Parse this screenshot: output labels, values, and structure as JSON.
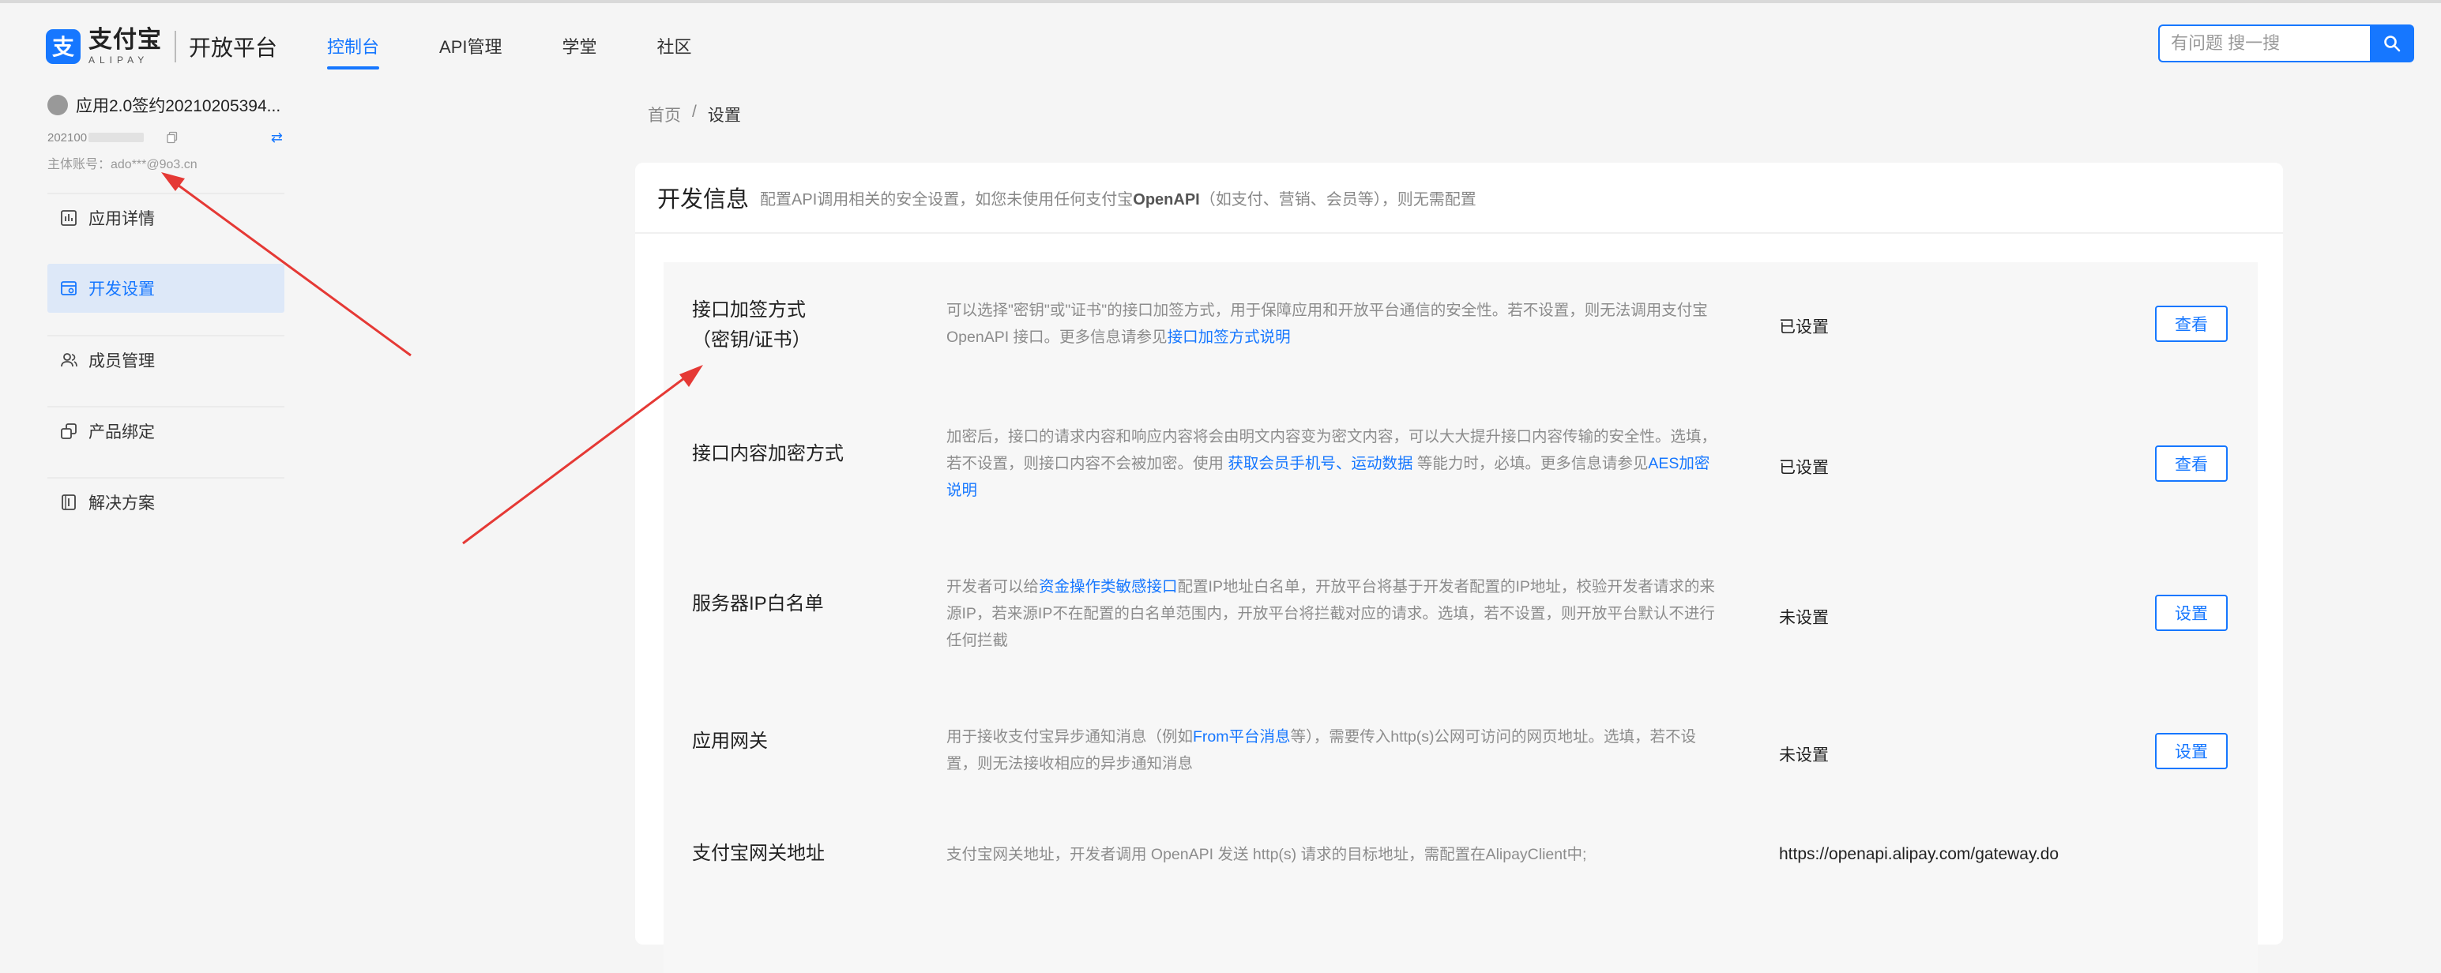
{
  "header": {
    "logo_cn": "支付宝",
    "logo_en": "ALIPAY",
    "platform": "开放平台",
    "nav": [
      {
        "label": "控制台",
        "active": true
      },
      {
        "label": "API管理",
        "active": false
      },
      {
        "label": "学堂",
        "active": false
      },
      {
        "label": "社区",
        "active": false
      }
    ],
    "search_placeholder": "有问题 搜一搜"
  },
  "sidebar": {
    "app_name": "应用2.0签约20210205394...",
    "app_id_prefix": "202100",
    "owner": "主体账号：ado***@9o3.cn",
    "items": [
      {
        "label": "应用详情",
        "icon": "chart-icon",
        "active": false
      },
      {
        "label": "开发设置",
        "icon": "dev-settings-icon",
        "active": true
      },
      {
        "label": "成员管理",
        "icon": "members-icon",
        "active": false
      },
      {
        "label": "产品绑定",
        "icon": "product-link-icon",
        "active": false
      },
      {
        "label": "解决方案",
        "icon": "solution-icon",
        "active": false
      }
    ]
  },
  "breadcrumb": {
    "home": "首页",
    "sep": "/",
    "current": "设置"
  },
  "card": {
    "title": "开发信息",
    "desc_prefix": "配置API调用相关的安全设置，如您未使用任何支付宝",
    "desc_bold": "OpenAPI",
    "desc_suffix": "（如支付、营销、会员等），则无需配置"
  },
  "rows": [
    {
      "name_line1": "接口加签方式",
      "name_line2": "（密钥/证书）",
      "desc_a": "可以选择\"密钥\"或\"证书\"的接口加签方式，用于保障应用和开放平台通信的安全性。若不设置，则无法调用支付宝 OpenAPI 接口。更多信息请参见",
      "desc_link": "接口加签方式说明",
      "status": "已设置",
      "button": "查看"
    },
    {
      "name": "接口内容加密方式",
      "desc_a": "加密后，接口的请求内容和响应内容将会由明文内容变为密文内容，可以大大提升接口内容传输的安全性。选填，若不设置，则接口内容不会被加密。使用 ",
      "desc_link1": "获取会员手机号",
      "desc_b": "、",
      "desc_link2": "运动数据",
      "desc_c": " 等能力时，必填。更多信息请参见",
      "desc_link3": "AES加密说明",
      "status": "已设置",
      "button": "查看"
    },
    {
      "name": "服务器IP白名单",
      "desc_a": "开发者可以给",
      "desc_link": "资金操作类敏感接口",
      "desc_b": "配置IP地址白名单，开放平台将基于开发者配置的IP地址，校验开发者请求的来源IP，若来源IP不在配置的白名单范围内，开放平台将拦截对应的请求。选填，若不设置，则开放平台默认不进行任何拦截",
      "status": "未设置",
      "button": "设置"
    },
    {
      "name": "应用网关",
      "desc_a": "用于接收支付宝异步通知消息（例如",
      "desc_link": "From平台消息",
      "desc_b": "等），需要传入http(s)公网可访问的网页地址。选填，若不设置，则无法接收相应的异步通知消息",
      "status": "未设置",
      "button": "设置"
    },
    {
      "name": "支付宝网关地址",
      "desc_a": "支付宝网关地址，开发者调用 OpenAPI 发送 http(s) 请求的目标地址，需配置在AlipayClient中;",
      "status": "https://openapi.alipay.com/gateway.do"
    }
  ],
  "colors": {
    "accent": "#1677ff",
    "annotation_arrow": "#e53935"
  }
}
